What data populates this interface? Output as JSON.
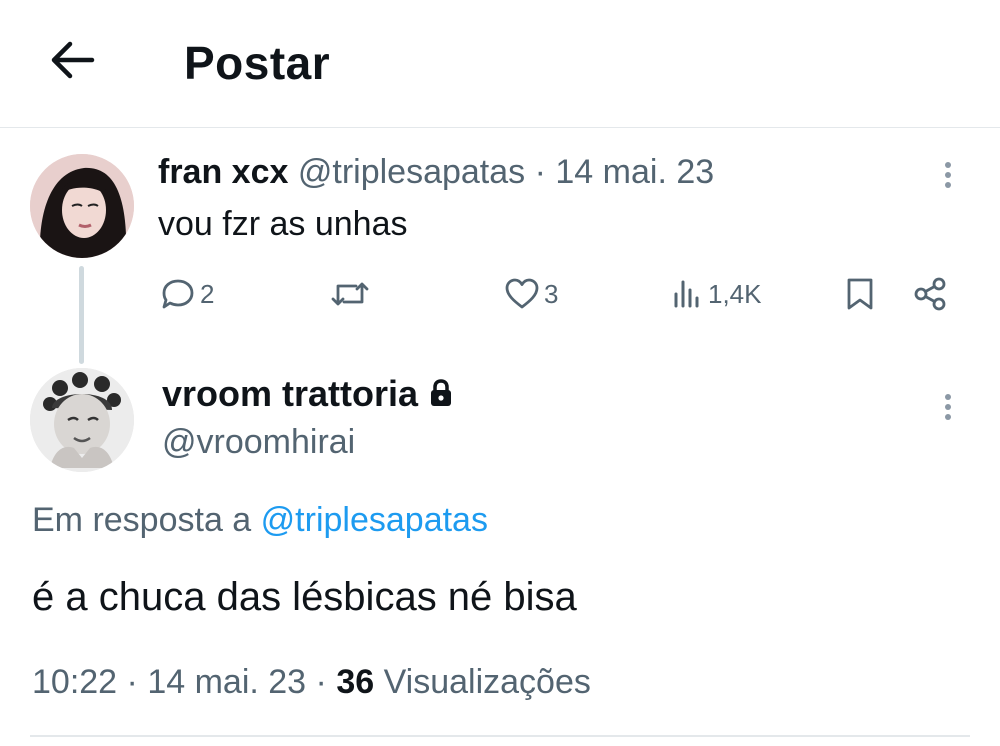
{
  "header": {
    "title": "Postar",
    "back_icon": "arrow-left-icon"
  },
  "parent_tweet": {
    "display_name": "fran xcx",
    "handle": "@triplesapatas",
    "separator": "·",
    "date": "14 mai. 23",
    "text": "vou fzr as unhas",
    "actions": {
      "reply_count": "2",
      "retweet_count": "",
      "like_count": "3",
      "views_count": "1,4K"
    }
  },
  "reply": {
    "display_name": "vroom trattoria",
    "handle": "@vroomhirai",
    "protected": true,
    "reply_prefix": "Em resposta a",
    "reply_mention": "@triplesapatas",
    "text": "é a chuca das lésbicas né bisa",
    "time": "10:22",
    "sep1": "·",
    "date": "14 mai. 23",
    "sep2": "·",
    "views": "36",
    "views_label": "Visualizações"
  },
  "colors": {
    "text_primary": "#0f1419",
    "text_secondary": "#536471",
    "link": "#1d9bf0",
    "divider": "#e4e8eb"
  }
}
